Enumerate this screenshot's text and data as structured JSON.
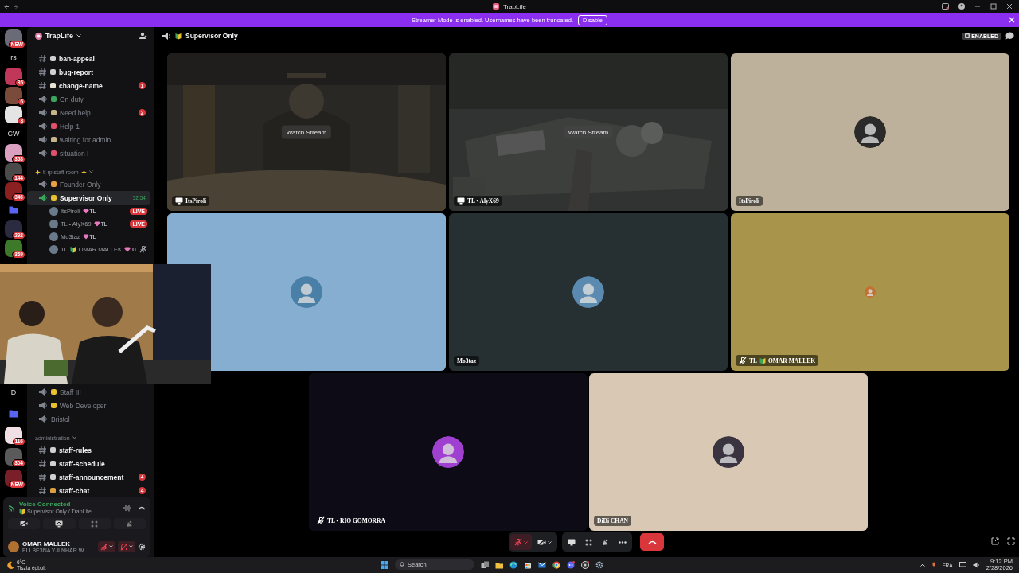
{
  "window": {
    "title": "TrapLife"
  },
  "banner": {
    "text": "Streamer Mode is enabled. Usernames have been truncated.",
    "button": "Disable"
  },
  "rail": {
    "top": [
      {
        "kind": "server",
        "badge": "NEW",
        "color": "#6b6b78"
      },
      {
        "kind": "label",
        "label": "rs"
      },
      {
        "kind": "server",
        "badge": "36",
        "color": "#c0375a"
      },
      {
        "kind": "server",
        "badge": "6",
        "color": "#7a4b3a"
      },
      {
        "kind": "server",
        "badge": "3",
        "color": "#e4e4e4"
      },
      {
        "kind": "label",
        "label": "CW"
      },
      {
        "kind": "server",
        "badge": "368",
        "color": "#d9a0c0"
      },
      {
        "kind": "server",
        "badge": "144",
        "color": "#4a4a4a"
      },
      {
        "kind": "server",
        "badge": "346",
        "color": "#8a2020"
      },
      {
        "kind": "folder"
      },
      {
        "kind": "server",
        "badge": "292",
        "color": "#2a2a40"
      },
      {
        "kind": "server",
        "badge": "369",
        "color": "#3c7a2a"
      }
    ],
    "bottom": [
      {
        "kind": "label",
        "label": "D"
      },
      {
        "kind": "folder"
      },
      {
        "kind": "server",
        "badge": "116",
        "color": "#f0e0e6"
      },
      {
        "kind": "server",
        "badge": "304",
        "color": "#5a5a5a"
      },
      {
        "kind": "server",
        "badge": "NEW",
        "color": "#7a1e2a"
      }
    ]
  },
  "sidebar": {
    "server": "TrapLife",
    "top": [
      {
        "kind": "text",
        "name": "ban-appeal",
        "unread": true,
        "color": "#cfcfd4"
      },
      {
        "kind": "text",
        "name": "bug-report",
        "unread": true,
        "color": "#cfcfd4"
      },
      {
        "kind": "text",
        "name": "change-name",
        "unread": true,
        "color": "#e8e0d0",
        "badge": "1"
      },
      {
        "kind": "voice",
        "name": "On duty",
        "unread": false,
        "color": "#3ba55c"
      },
      {
        "kind": "voice",
        "name": "Need help",
        "unread": false,
        "color": "#c8b48a",
        "badge": "2"
      },
      {
        "kind": "voice",
        "name": "Help-1",
        "unread": false,
        "color": "#e0506a"
      },
      {
        "kind": "voice",
        "name": "waiting for admin",
        "unread": false,
        "color": "#c8b48a"
      },
      {
        "kind": "voice",
        "name": "situation I",
        "unread": false,
        "color": "#e0506a"
      },
      {
        "kind": "category",
        "name": "tl rp staff room",
        "sparkles": true
      },
      {
        "kind": "voice",
        "name": "Founder Only",
        "unread": false,
        "color": "#e8a040"
      },
      {
        "kind": "voice",
        "name": "Supervisor Only",
        "unread": true,
        "selected": true,
        "color": "#e8c030",
        "timer": "32:54",
        "children": [
          {
            "name": "ItsPiroli",
            "tag": "TL",
            "badge": "LIVE",
            "muted": false
          },
          {
            "name": "TL • AlyX69",
            "tag": "TL",
            "badge": "LIVE",
            "muted": false
          },
          {
            "name": "Mo3taz",
            "tag": "TL",
            "muted": false
          },
          {
            "prefix": "TL",
            "leaf": true,
            "name": "OMAR MALLEK",
            "tag": "TI",
            "muted": true
          }
        ]
      }
    ],
    "bottom": [
      {
        "kind": "voice",
        "name": "Staff III",
        "unread": false,
        "color": "#e8c030"
      },
      {
        "kind": "voice",
        "name": "Web Developer",
        "unread": false,
        "color": "#e8c030"
      },
      {
        "kind": "voice",
        "name": "Bristol",
        "unread": false
      },
      {
        "kind": "category",
        "name": "administration",
        "sparkles": false
      },
      {
        "kind": "text",
        "name": "staff-rules",
        "unread": true,
        "color": "#cfcfd4"
      },
      {
        "kind": "text",
        "name": "staff-schedule",
        "unread": true,
        "color": "#cfcfd4"
      },
      {
        "kind": "text",
        "name": "staff-announcement",
        "unread": true,
        "color": "#cfcfd4",
        "badge": "4"
      },
      {
        "kind": "text",
        "name": "staff-chat",
        "unread": true,
        "color": "#d8a040",
        "badge": "4"
      }
    ],
    "voice": {
      "status": "Voice Connected",
      "channel": "Supervisor Only / TrapLife"
    },
    "user": {
      "name": "OMAR MALLEK",
      "status": "ELI BE3NA YJI NHAR W",
      "mic_muted": true,
      "deafened": true
    }
  },
  "stage": {
    "channel": "Supervisor Only",
    "badge": "ENABLED",
    "rows": [
      [
        {
          "kind": "stream",
          "button": "Watch Stream",
          "label": "ItsPiroli"
        },
        {
          "kind": "stream",
          "button": "Watch Stream",
          "label": "TL • AlyX69"
        },
        {
          "kind": "avatar",
          "color": "#beb19b",
          "avatar": {
            "color": "#2a2a2a"
          },
          "label": "ItsPiroli",
          "muted": false
        }
      ],
      [
        {
          "kind": "avatar",
          "color": "#86aed0",
          "avatar": {
            "color": "#4a7fa8"
          },
          "muted": false
        },
        {
          "kind": "avatar",
          "color": "#263033",
          "avatar": {
            "color": "#5a8ab0"
          },
          "label": "Mo3taz",
          "muted": false
        },
        {
          "kind": "avatar",
          "color": "#a8944a",
          "avatar": {
            "color": "#c07030"
          },
          "small": true,
          "prefix": "TL",
          "leaf": true,
          "label": "OMAR MALLEK",
          "muted": true
        }
      ],
      [
        {
          "kind": "avatar",
          "color": "#0d0b16",
          "avatar": {
            "color": "#a040d0"
          },
          "label": "TL • RIO GOMORRA",
          "muted": true,
          "plain": true
        },
        {
          "kind": "avatar",
          "color": "#d8c8b4",
          "avatar": {
            "color": "#3a3440"
          },
          "label": "DiDi CHAN",
          "muted": false
        }
      ]
    ],
    "controls": {
      "mic_muted": true,
      "camera_on": false
    }
  },
  "taskbar": {
    "temp": "6°C",
    "weather": "Tiszta égbolt",
    "placeholder": "Search",
    "lang": "FRA",
    "time": "9:12 PM",
    "date": "2/28/2026"
  }
}
